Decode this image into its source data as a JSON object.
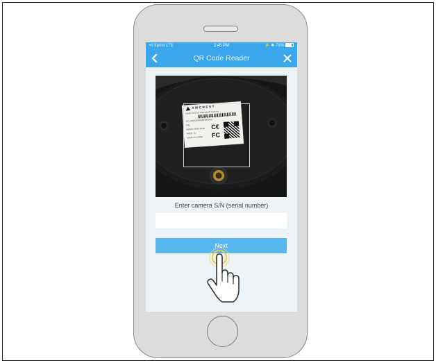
{
  "statusbar": {
    "carrier": "•ıl Sprint LTE",
    "time": "2:45 PM",
    "right": "⚡ ✱ 79%"
  },
  "navbar": {
    "title": "QR Code Reader",
    "back_icon": "chevron-left-icon",
    "close_icon": "close-icon"
  },
  "camera": {
    "brand": "AMCREST",
    "label_lines": [
      "1080P P&T HD Wireless IP Camera",
      "S/N: AMC000000000000000",
      "P/N: ",
      "MODEL:IP2M-841B",
      "INPUT: 5V ",
      "MADE IN CHINA"
    ]
  },
  "form": {
    "sn_label": "Enter camera S/N (serial number)",
    "sn_value": "",
    "next_label": "Next"
  },
  "colors": {
    "accent": "#3aa6ec",
    "button": "#58b6ef",
    "screen_bg": "#eef3f7",
    "tap_ring": "#f2d36b"
  },
  "icons": [
    "chevron-left-icon",
    "close-icon",
    "pointing-hand-icon",
    "tap-ring-icon",
    "home-button-icon"
  ]
}
